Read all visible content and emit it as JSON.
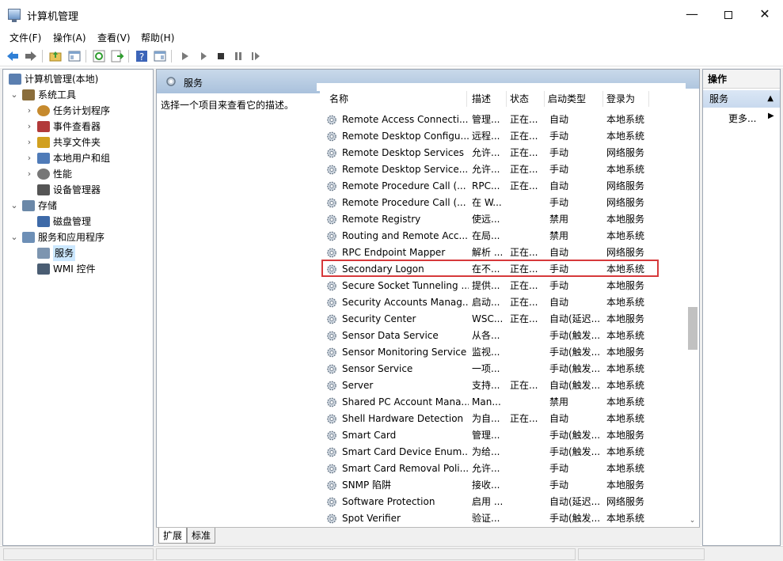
{
  "window": {
    "title": "计算机管理"
  },
  "menu": [
    "文件(F)",
    "操作(A)",
    "查看(V)",
    "帮助(H)"
  ],
  "tree": [
    {
      "label": "计算机管理(本地)",
      "level": 0,
      "expander": "",
      "icon": "computer-management-icon"
    },
    {
      "label": "系统工具",
      "level": 1,
      "expander": "⌄",
      "icon": "tools-icon"
    },
    {
      "label": "任务计划程序",
      "level": 2,
      "expander": "›",
      "icon": "clock-icon"
    },
    {
      "label": "事件查看器",
      "level": 2,
      "expander": "›",
      "icon": "event-viewer-icon"
    },
    {
      "label": "共享文件夹",
      "level": 2,
      "expander": "›",
      "icon": "shared-folder-icon"
    },
    {
      "label": "本地用户和组",
      "level": 2,
      "expander": "›",
      "icon": "users-icon"
    },
    {
      "label": "性能",
      "level": 2,
      "expander": "›",
      "icon": "performance-icon"
    },
    {
      "label": "设备管理器",
      "level": 2,
      "expander": "",
      "icon": "device-manager-icon"
    },
    {
      "label": "存储",
      "level": 1,
      "expander": "⌄",
      "icon": "storage-icon"
    },
    {
      "label": "磁盘管理",
      "level": 2,
      "expander": "",
      "icon": "disk-icon"
    },
    {
      "label": "服务和应用程序",
      "level": 1,
      "expander": "⌄",
      "icon": "services-apps-icon"
    },
    {
      "label": "服务",
      "level": 2,
      "expander": "",
      "icon": "services-icon",
      "selected": true
    },
    {
      "label": "WMI 控件",
      "level": 2,
      "expander": "",
      "icon": "wmi-icon"
    }
  ],
  "center": {
    "title": "服务",
    "description": "选择一个项目来查看它的描述。",
    "sort_indicator": "^",
    "columns": [
      "名称",
      "描述",
      "状态",
      "启动类型",
      "登录为"
    ],
    "rows": [
      [
        "Remote Access Connecti...",
        "管理...",
        "正在...",
        "自动",
        "本地系统"
      ],
      [
        "Remote Desktop Configu...",
        "远程...",
        "正在...",
        "手动",
        "本地系统"
      ],
      [
        "Remote Desktop Services",
        "允许...",
        "正在...",
        "手动",
        "网络服务"
      ],
      [
        "Remote Desktop Service...",
        "允许...",
        "正在...",
        "手动",
        "本地系统"
      ],
      [
        "Remote Procedure Call (...",
        "RPC...",
        "正在...",
        "自动",
        "网络服务"
      ],
      [
        "Remote Procedure Call (...",
        "在 W...",
        "",
        "手动",
        "网络服务"
      ],
      [
        "Remote Registry",
        "使远...",
        "",
        "禁用",
        "本地服务"
      ],
      [
        "Routing and Remote Acc...",
        "在局...",
        "",
        "禁用",
        "本地系统"
      ],
      [
        "RPC Endpoint Mapper",
        "解析 ...",
        "正在...",
        "自动",
        "网络服务"
      ],
      [
        "Secondary Logon",
        "在不...",
        "正在...",
        "手动",
        "本地系统"
      ],
      [
        "Secure Socket Tunneling ...",
        "提供...",
        "正在...",
        "手动",
        "本地服务"
      ],
      [
        "Security Accounts Manag...",
        "启动...",
        "正在...",
        "自动",
        "本地系统"
      ],
      [
        "Security Center",
        "WSC...",
        "正在...",
        "自动(延迟...",
        "本地服务"
      ],
      [
        "Sensor Data Service",
        "从各...",
        "",
        "手动(触发...",
        "本地系统"
      ],
      [
        "Sensor Monitoring Service",
        "监视...",
        "",
        "手动(触发...",
        "本地服务"
      ],
      [
        "Sensor Service",
        "一项...",
        "",
        "手动(触发...",
        "本地系统"
      ],
      [
        "Server",
        "支持...",
        "正在...",
        "自动(触发...",
        "本地系统"
      ],
      [
        "Shared PC Account Mana...",
        "Man...",
        "",
        "禁用",
        "本地系统"
      ],
      [
        "Shell Hardware Detection",
        "为自...",
        "正在...",
        "自动",
        "本地系统"
      ],
      [
        "Smart Card",
        "管理...",
        "",
        "手动(触发...",
        "本地服务"
      ],
      [
        "Smart Card Device Enum...",
        "为给...",
        "",
        "手动(触发...",
        "本地系统"
      ],
      [
        "Smart Card Removal Poli...",
        "允许...",
        "",
        "手动",
        "本地系统"
      ],
      [
        "SNMP 陷阱",
        "接收...",
        "",
        "手动",
        "本地服务"
      ],
      [
        "Software Protection",
        "启用 ...",
        "",
        "自动(延迟...",
        "网络服务"
      ],
      [
        "Spot Verifier",
        "验证...",
        "",
        "手动(触发...",
        "本地系统"
      ]
    ],
    "highlighted_row": 9,
    "highlight_color": "#d6393b",
    "tabs": [
      "扩展",
      "标准"
    ]
  },
  "actions": {
    "title": "操作",
    "group": "服务",
    "more": "更多..."
  }
}
